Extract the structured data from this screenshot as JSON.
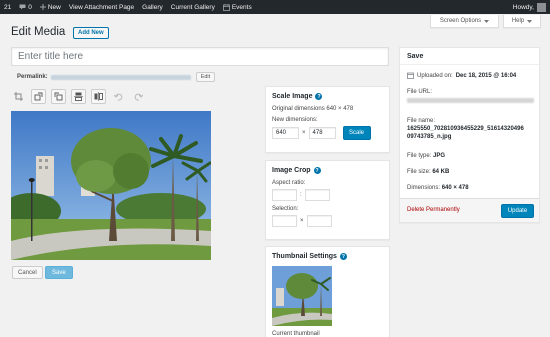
{
  "adminbar": {
    "site_number": "21",
    "comments_count": "0",
    "new_label": "New",
    "view_attachment": "View Attachment Page",
    "gallery": "Gallery",
    "current_gallery": "Current Gallery",
    "events": "Events",
    "howdy": "Howdy,"
  },
  "screen_meta": {
    "screen_options": "Screen Options",
    "help": "Help"
  },
  "page": {
    "title": "Edit Media",
    "add_new": "Add New",
    "title_placeholder": "Enter title here",
    "permalink_label": "Permalink:",
    "edit": "Edit"
  },
  "editor": {
    "cancel": "Cancel",
    "save": "Save"
  },
  "scale": {
    "heading": "Scale Image",
    "help": "?",
    "original": "Original dimensions 640 × 478",
    "new_dimensions": "New dimensions:",
    "width": "640",
    "times": "×",
    "height": "478",
    "button": "Scale"
  },
  "crop": {
    "heading": "Image Crop",
    "help": "?",
    "aspect_ratio": "Aspect ratio:",
    "colon": ":",
    "selection": "Selection:",
    "times": "×"
  },
  "thumbnail": {
    "heading": "Thumbnail Settings",
    "help": "?",
    "current": "Current thumbnail"
  },
  "save_box": {
    "heading": "Save",
    "uploaded_label": "Uploaded on:",
    "uploaded_value": "Dec 18, 2015 @ 16:04",
    "file_url_label": "File URL:",
    "file_name_label": "File name:",
    "file_name_line1": "1625550_702810936455229_51614320496",
    "file_name_line2": "09743785_n.jpg",
    "file_type_label": "File type:",
    "file_type_value": "JPG",
    "file_size_label": "File size:",
    "file_size_value": "64 KB",
    "dimensions_label": "Dimensions:",
    "dimensions_value": "640 × 478",
    "delete": "Delete Permanently",
    "update": "Update"
  },
  "colors": {
    "adminbar": "#23282d",
    "primary": "#0085ba",
    "delete": "#a00"
  }
}
